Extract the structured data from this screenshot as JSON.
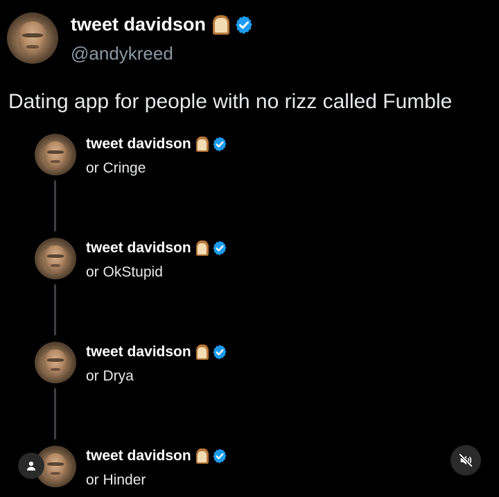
{
  "main_tweet": {
    "display_name": "tweet davidson",
    "handle": "@andykreed",
    "text": "Dating app for people with no rizz called Fumble",
    "icons": [
      "bread-emoji",
      "verified-badge"
    ]
  },
  "replies": [
    {
      "display_name": "tweet davidson",
      "text": "or Cringe"
    },
    {
      "display_name": "tweet davidson",
      "text": "or OkStupid"
    },
    {
      "display_name": "tweet davidson",
      "text": "or Drya"
    },
    {
      "display_name": "tweet davidson",
      "text": "or Hinder"
    }
  ],
  "controls": {
    "account_icon": "person-icon",
    "mute_icon": "speaker-muted-icon"
  },
  "colors": {
    "background": "#000000",
    "text": "#e7e9ea",
    "handle": "#8b98a5",
    "verified": "#1d9bf0",
    "thread_line": "#3e4144"
  }
}
